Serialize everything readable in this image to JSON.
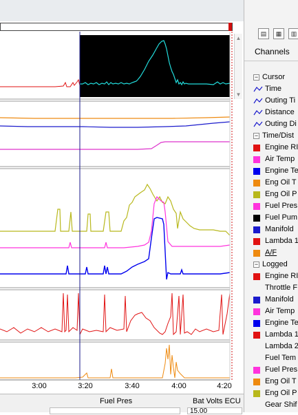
{
  "colors": {
    "red": "#e11212",
    "magenta": "#ff33dd",
    "blue": "#0000ee",
    "orange": "#ee8a10",
    "olive": "#b8b81c",
    "black": "#000000",
    "cyan": "#22dddd",
    "darkblue": "#1a1acc"
  },
  "x_axis": {
    "ticks": [
      "3:00",
      "3:20",
      "3:40",
      "4:00",
      "4:20"
    ]
  },
  "status": {
    "fuel_pres_label": "Fuel Pres",
    "bat_volts_label": "Bat Volts ECU",
    "bat_volts_value": "15.00"
  },
  "sidebar": {
    "title": "Channels",
    "toolbar_icons": [
      "split-view-icon",
      "chart-options-icon",
      "layout-icon"
    ],
    "groups": [
      {
        "label": "Cursor",
        "expanded": "−",
        "items": [
          {
            "label": "Time",
            "kind": "cursor"
          },
          {
            "label": "Outing Ti",
            "kind": "cursor"
          },
          {
            "label": "Distance",
            "kind": "cursor"
          },
          {
            "label": "Outing Di",
            "kind": "cursor"
          }
        ]
      },
      {
        "label": "Time/Dist",
        "expanded": "−",
        "items": [
          {
            "label": "Engine RI",
            "color": "#e11212"
          },
          {
            "label": "Air Temp",
            "color": "#ff33dd"
          },
          {
            "label": "Engine Te",
            "color": "#0000ee"
          },
          {
            "label": "Eng Oil T",
            "color": "#ee8a10"
          },
          {
            "label": "Eng Oil P",
            "color": "#b8b81c"
          },
          {
            "label": "Fuel Pres",
            "color": "#ff33dd"
          },
          {
            "label": "Fuel Pum",
            "color": "#000000"
          },
          {
            "label": "Manifold",
            "color": "#1a1acc"
          },
          {
            "label": "Lambda 1",
            "color": "#e11212"
          },
          {
            "label": "A/F",
            "color": "#ee8a10",
            "underline": true
          }
        ]
      },
      {
        "label": "Logged",
        "expanded": "−",
        "items": [
          {
            "label": "Engine RI",
            "color": "#e11212"
          },
          {
            "label": "Throttle F",
            "color": ""
          },
          {
            "label": "Manifold",
            "color": "#1a1acc"
          },
          {
            "label": "Air Temp",
            "color": "#ff33dd"
          },
          {
            "label": "Engine Te",
            "color": "#0000ee"
          },
          {
            "label": "Lambda 1",
            "color": "#e11212"
          },
          {
            "label": "Lambda 2",
            "color": ""
          },
          {
            "label": "Fuel Tem",
            "color": ""
          },
          {
            "label": "Fuel Pres",
            "color": "#ff33dd"
          },
          {
            "label": "Eng Oil T",
            "color": "#ee8a10"
          },
          {
            "label": "Eng Oil P",
            "color": "#b8b81c"
          },
          {
            "label": "Gear Shif",
            "color": ""
          }
        ]
      }
    ]
  }
}
